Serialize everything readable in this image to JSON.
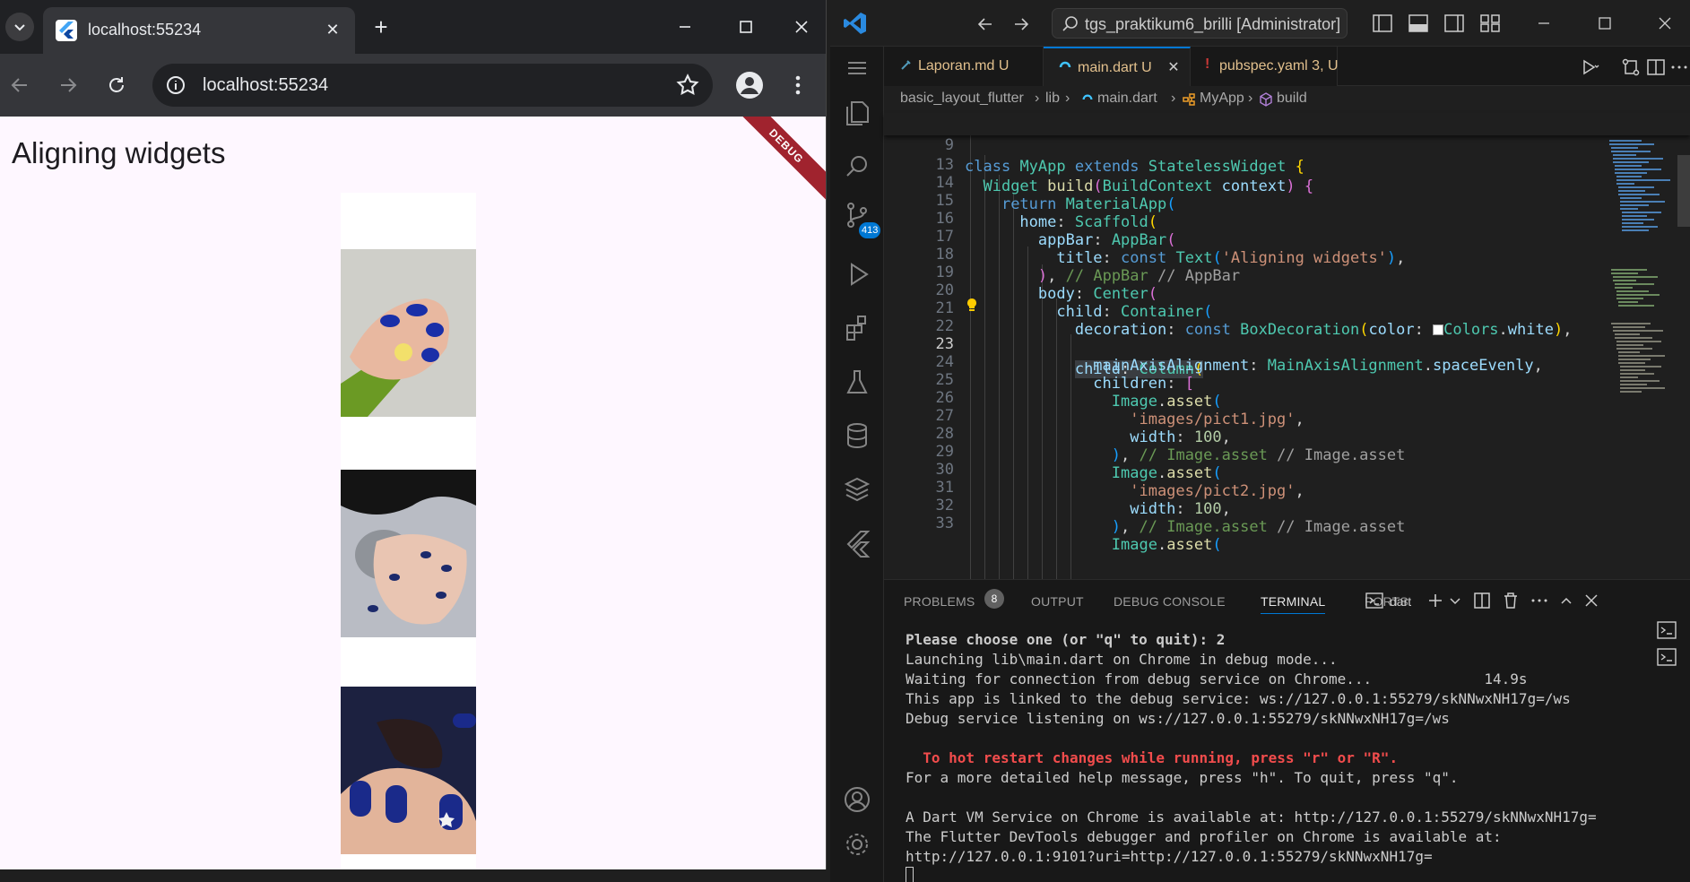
{
  "chrome": {
    "tab_title": "localhost:55234",
    "url": "localhost:55234",
    "app_title": "Aligning widgets",
    "debug_banner": "DEBUG",
    "images": [
      "nail-photo-1",
      "nail-photo-2",
      "nail-photo-3"
    ]
  },
  "vscode": {
    "search_text": "tgs_praktikum6_brilli [Administrator]",
    "scm_badge": "413",
    "tabs": [
      {
        "label": "Laporan.md",
        "status": "U"
      },
      {
        "label": "main.dart",
        "status": "U"
      },
      {
        "label": "pubspec.yaml",
        "status": "3, U"
      }
    ],
    "breadcrumb": [
      "basic_layout_flutter",
      "lib",
      "main.dart",
      "MyApp",
      "build"
    ],
    "sticky_line_number": "9",
    "code_lines": [
      {
        "n": "13"
      },
      {
        "n": "14"
      },
      {
        "n": "15"
      },
      {
        "n": "16"
      },
      {
        "n": "17"
      },
      {
        "n": "18"
      },
      {
        "n": "19"
      },
      {
        "n": "20"
      },
      {
        "n": "21"
      },
      {
        "n": "22"
      },
      {
        "n": "23"
      },
      {
        "n": "24"
      },
      {
        "n": "25"
      },
      {
        "n": "26"
      },
      {
        "n": "27"
      },
      {
        "n": "28"
      },
      {
        "n": "29"
      },
      {
        "n": "30"
      },
      {
        "n": "31"
      },
      {
        "n": "32"
      },
      {
        "n": "33"
      }
    ],
    "panel": {
      "tabs": [
        "PROBLEMS",
        "OUTPUT",
        "DEBUG CONSOLE",
        "TERMINAL",
        "PORTS"
      ],
      "problems_count": "8",
      "terminal_profile": "dart",
      "terminal_lines": [
        "Please choose one (or \"q\" to quit): 2",
        "Launching lib\\main.dart on Chrome in debug mode...",
        "Waiting for connection from debug service on Chrome...             14.9s",
        "This app is linked to the debug service: ws://127.0.0.1:55279/skNNwxNH17g=/ws",
        "Debug service listening on ws://127.0.0.1:55279/skNNwxNH17g=/ws",
        "",
        "  To hot restart changes while running, press \"r\" or \"R\".",
        "For a more detailed help message, press \"h\". To quit, press \"q\".",
        "",
        "A Dart VM Service on Chrome is available at: http://127.0.0.1:55279/skNNwxNH17g=",
        "The Flutter DevTools debugger and profiler on Chrome is available at:",
        "http://127.0.0.1:9101?uri=http://127.0.0.1:55279/skNNwxNH17g="
      ]
    }
  },
  "colors": {
    "vscode_accent": "#0078d4",
    "debug_banner": "#a0232e",
    "flutter_bg": "#fef7ff"
  }
}
